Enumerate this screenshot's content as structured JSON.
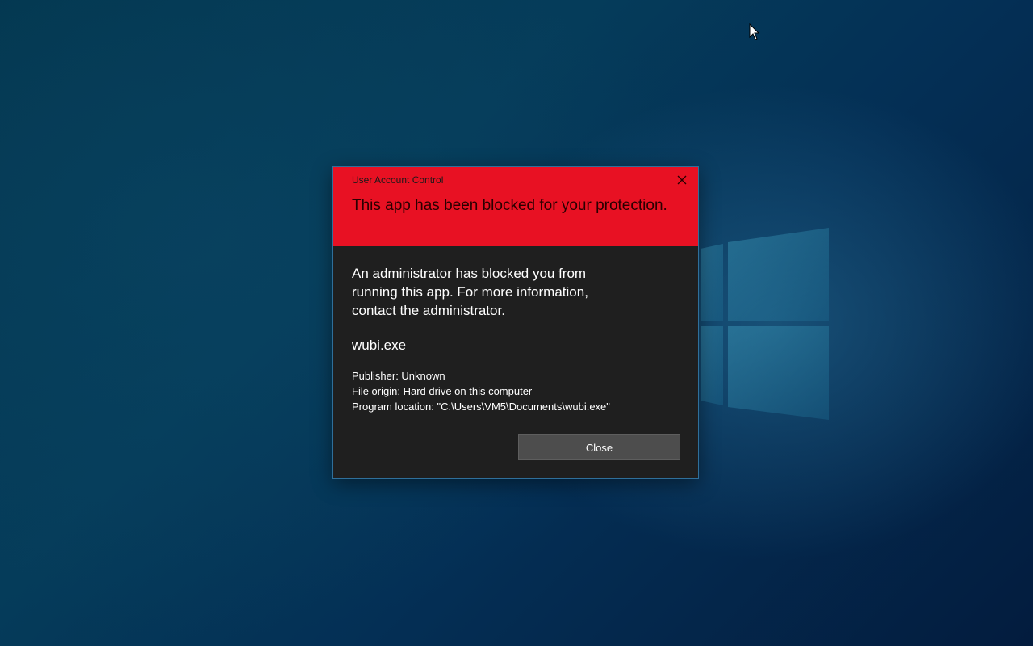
{
  "desktop": {
    "background_color": "#053c5a",
    "logo_icon": "windows-logo-icon",
    "cursor_icon": "mouse-pointer-icon"
  },
  "dialog": {
    "caption": "User Account Control",
    "close_icon": "close-icon",
    "headline": "This app has been blocked for your protection.",
    "header_color": "#e81123",
    "body_color": "#1f1f1f",
    "message": "An administrator has blocked you from running this app. For more information, contact the administrator.",
    "app_name": "wubi.exe",
    "publisher": "Publisher: Unknown",
    "file_origin": "File origin: Hard drive on this computer",
    "program_location": "Program location: \"C:\\Users\\VM5\\Documents\\wubi.exe\"",
    "close_button_label": "Close"
  }
}
